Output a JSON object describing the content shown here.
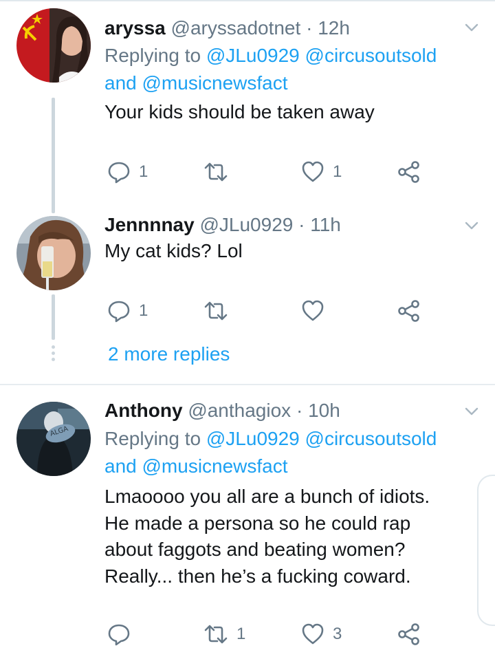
{
  "tweets": [
    {
      "name": "aryssa",
      "handle": "@aryssadotnet",
      "time": "12h",
      "replying_prefix": "Replying to ",
      "reply_to_1": "@JLu0929",
      "reply_to_2": "@circusoutsold",
      "reply_to_and": "and ",
      "reply_to_3": "@musicnewsfact",
      "text": "Your kids should be taken away",
      "reply_count": "1",
      "retweet_count": "",
      "like_count": "1"
    },
    {
      "name": "Jennnnay",
      "handle": "@JLu0929",
      "time": "11h",
      "text": "My cat kids? Lol",
      "reply_count": "1",
      "retweet_count": "",
      "like_count": ""
    },
    {
      "name": "Anthony",
      "handle": "@anthagiox",
      "time": "10h",
      "replying_prefix": "Replying to ",
      "reply_to_1": "@JLu0929",
      "reply_to_2": "@circusoutsold",
      "reply_to_and": "and ",
      "reply_to_3": "@musicnewsfact",
      "text_lines": [
        "Lmaoooo you all are a bunch of idiots.",
        "He made a persona so he could rap",
        "about faggots and beating women?",
        "Really... then he’s a fucking coward."
      ],
      "reply_count": "",
      "retweet_count": "1",
      "like_count": "3"
    }
  ],
  "more_replies": "2 more replies",
  "separator": " · ",
  "colors": {
    "link": "#1da1f2",
    "secondary_text": "#657786",
    "primary_text": "#14171a",
    "icon": "#657786",
    "thread_line": "#ccd6dd",
    "divider": "#e6ecf0"
  },
  "icons": [
    "reply-icon",
    "retweet-icon",
    "like-icon",
    "share-icon",
    "caret-down-icon"
  ]
}
